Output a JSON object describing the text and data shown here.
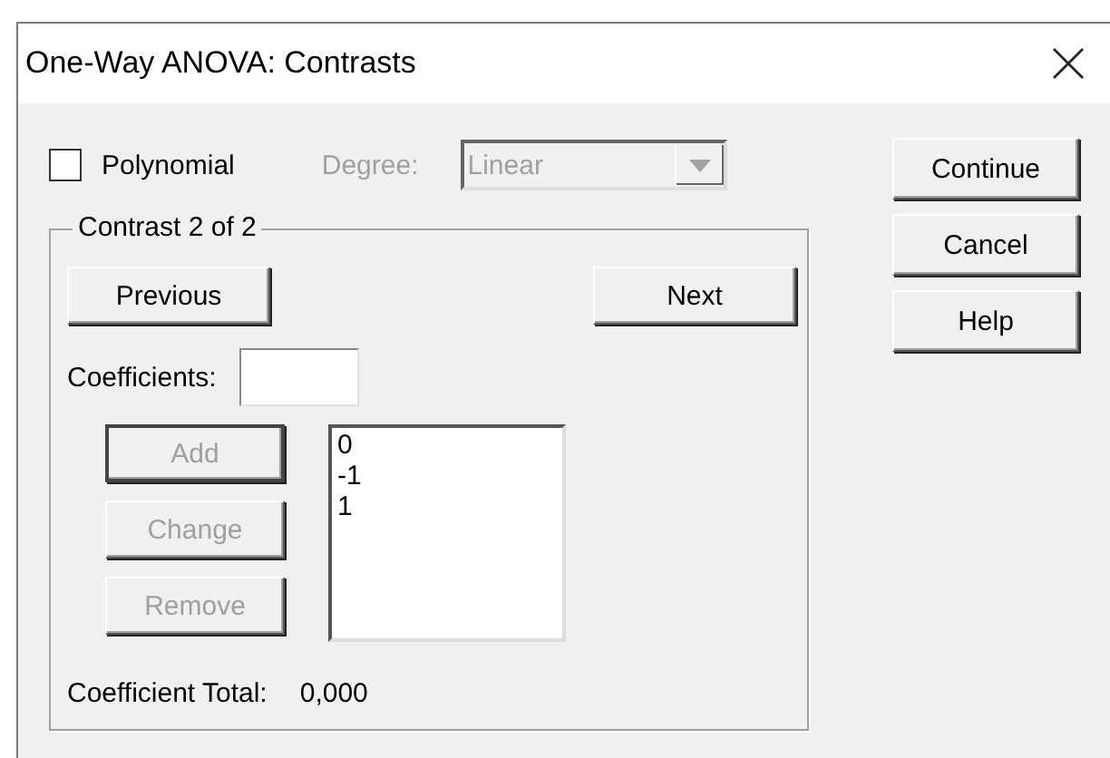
{
  "window": {
    "title": "One-Way ANOVA: Contrasts"
  },
  "polynomial": {
    "label": "Polynomial",
    "checked": false
  },
  "degree": {
    "label": "Degree:",
    "value": "Linear",
    "disabled": true
  },
  "contrast_group": {
    "title": "Contrast 2 of 2",
    "previous": "Previous",
    "next": "Next"
  },
  "coefficients": {
    "label": "Coefficients:"
  },
  "edit_buttons": [
    {
      "label": "Add",
      "disabled": true
    },
    {
      "label": "Change",
      "disabled": true
    },
    {
      "label": "Remove",
      "disabled": true
    }
  ],
  "coefficient_list": [
    "0",
    "-1",
    "1"
  ],
  "total": {
    "label": "Coefficient Total:",
    "value": "0,000"
  },
  "dialog_buttons": [
    "Continue",
    "Cancel",
    "Help"
  ]
}
